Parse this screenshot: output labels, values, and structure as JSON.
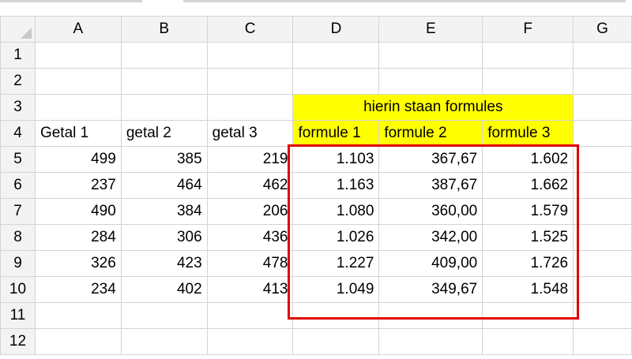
{
  "columns": [
    "A",
    "B",
    "C",
    "D",
    "E",
    "F",
    "G"
  ],
  "rows": [
    "1",
    "2",
    "3",
    "4",
    "5",
    "6",
    "7",
    "8",
    "9",
    "10",
    "11",
    "12"
  ],
  "header_row3": {
    "merged_DEF": "hierin staan formules"
  },
  "header_row4": {
    "A": "Getal 1",
    "B": "getal 2",
    "C": "getal 3",
    "D": "formule 1",
    "E": "formule 2",
    "F": "formule 3"
  },
  "data": [
    {
      "A": "499",
      "B": "385",
      "C": "219",
      "D": "1.103",
      "E": "367,67",
      "F": "1.602"
    },
    {
      "A": "237",
      "B": "464",
      "C": "462",
      "D": "1.163",
      "E": "387,67",
      "F": "1.662"
    },
    {
      "A": "490",
      "B": "384",
      "C": "206",
      "D": "1.080",
      "E": "360,00",
      "F": "1.579"
    },
    {
      "A": "284",
      "B": "306",
      "C": "436",
      "D": "1.026",
      "E": "342,00",
      "F": "1.525"
    },
    {
      "A": "326",
      "B": "423",
      "C": "478",
      "D": "1.227",
      "E": "409,00",
      "F": "1.726"
    },
    {
      "A": "234",
      "B": "402",
      "C": "413",
      "D": "1.049",
      "E": "349,67",
      "F": "1.548"
    }
  ],
  "colors": {
    "highlight": "#ffff00",
    "annotation_box": "#e00000",
    "gridline": "#d4d4d4"
  }
}
